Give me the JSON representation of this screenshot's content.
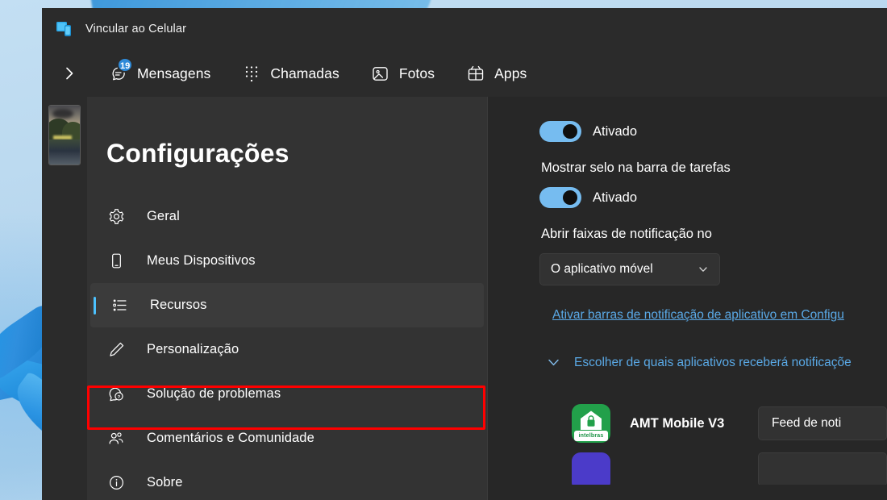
{
  "window": {
    "title": "Vincular ao Celular",
    "app_icon": "phone-link-icon"
  },
  "navbar": {
    "expand_icon": "chevron-right-icon",
    "items": [
      {
        "label": "Mensagens",
        "icon": "messages-icon",
        "badge": "19"
      },
      {
        "label": "Chamadas",
        "icon": "dialpad-icon",
        "badge": ""
      },
      {
        "label": "Fotos",
        "icon": "photos-icon",
        "badge": ""
      },
      {
        "label": "Apps",
        "icon": "apps-grid-icon",
        "badge": ""
      }
    ]
  },
  "sidebar": {
    "title": "Configurações",
    "device_thumbnail": "device-wallpaper-thumbnail",
    "items": [
      {
        "label": "Geral",
        "icon": "gear-icon",
        "selected": false
      },
      {
        "label": "Meus Dispositivos",
        "icon": "phone-icon",
        "selected": false
      },
      {
        "label": "Recursos",
        "icon": "list-icon",
        "selected": true
      },
      {
        "label": "Personalização",
        "icon": "pen-icon",
        "selected": false
      },
      {
        "label": "Solução de problemas",
        "icon": "help-chat-icon",
        "selected": false
      },
      {
        "label": "Comentários e Comunidade",
        "icon": "people-icon",
        "selected": false
      },
      {
        "label": "Sobre",
        "icon": "info-icon",
        "selected": false
      }
    ]
  },
  "highlight": {
    "color": "#ff0000",
    "target": "Recursos"
  },
  "right_panel": {
    "toggle_top": {
      "state_label": "Ativado",
      "on": true
    },
    "badge_setting_label": "Mostrar selo na barra de tarefas",
    "toggle_badge": {
      "state_label": "Ativado",
      "on": true
    },
    "banner_setting_label": "Abrir faixas de notificação no",
    "dropdown": {
      "value": "O aplicativo móvel",
      "chevron": "chevron-down-icon"
    },
    "settings_link": "Ativar barras de notificação de aplicativo em Configu",
    "expander": {
      "label": "Escolher de quais aplicativos receberá notificaçõe",
      "icon": "chevron-down-icon"
    },
    "apps": [
      {
        "name": "AMT Mobile V3",
        "icon": "amt-mobile-app-icon",
        "icon_brand": "intelbras",
        "action_label": "Feed de noti"
      },
      {
        "name": "",
        "icon": "purple-app-icon",
        "icon_brand": "",
        "action_label": ""
      }
    ]
  },
  "colors": {
    "accent": "#4cc2ff",
    "link": "#5aa9e6",
    "toggle_on": "#76bcf0",
    "highlight": "#ff0000",
    "sidebar_bg": "#333333",
    "panel_bg": "#272727"
  }
}
